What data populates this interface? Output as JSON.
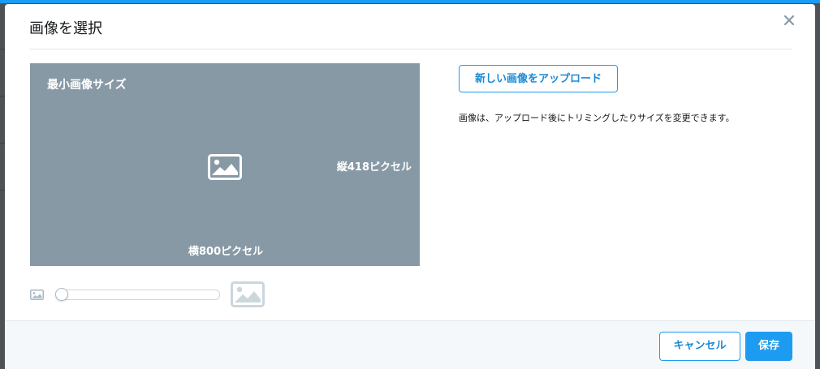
{
  "dialog": {
    "title": "画像を選択"
  },
  "preview": {
    "title": "最小画像サイズ",
    "height_label": "縦418ピクセル",
    "width_label": "横800ピクセル",
    "icon": "image-icon"
  },
  "zoom": {
    "level": 0,
    "small_icon": "image-small-icon",
    "large_icon": "image-large-icon"
  },
  "upload": {
    "button_label": "新しい画像をアップロード",
    "hint": "画像は、アップロード後にトリミングしたりサイズを変更できます。"
  },
  "footer": {
    "cancel_label": "キャンセル",
    "save_label": "保存"
  },
  "colors": {
    "accent": "#1d9bf0",
    "preview_bg": "#8899a6",
    "footer_bg": "#f5f8fa"
  }
}
